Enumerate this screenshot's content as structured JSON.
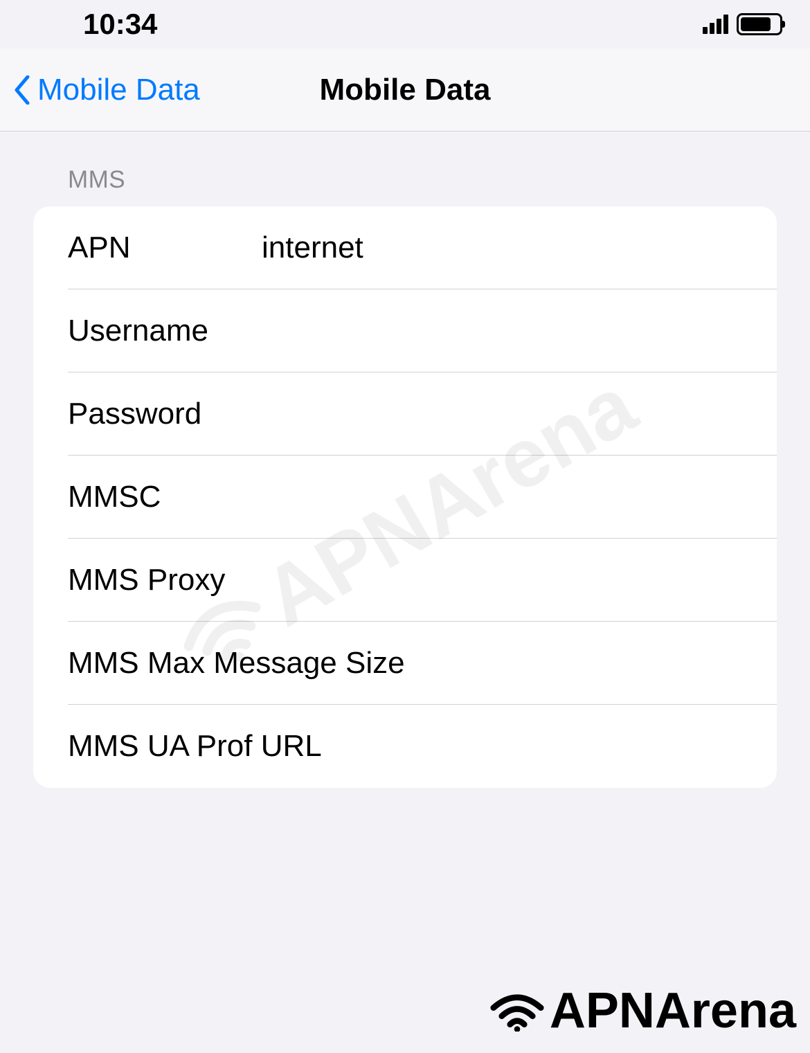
{
  "status_bar": {
    "time": "10:34"
  },
  "nav": {
    "back_label": "Mobile Data",
    "title": "Mobile Data"
  },
  "section": {
    "header": "MMS"
  },
  "fields": {
    "apn_label": "APN",
    "apn_value": "internet",
    "username_label": "Username",
    "username_value": "",
    "password_label": "Password",
    "password_value": "",
    "mmsc_label": "MMSC",
    "mmsc_value": "",
    "mms_proxy_label": "MMS Proxy",
    "mms_proxy_value": "",
    "mms_max_label": "MMS Max Message Size",
    "mms_max_value": "",
    "mms_ua_label": "MMS UA Prof URL",
    "mms_ua_value": ""
  },
  "watermark": {
    "text": "APNArena"
  }
}
